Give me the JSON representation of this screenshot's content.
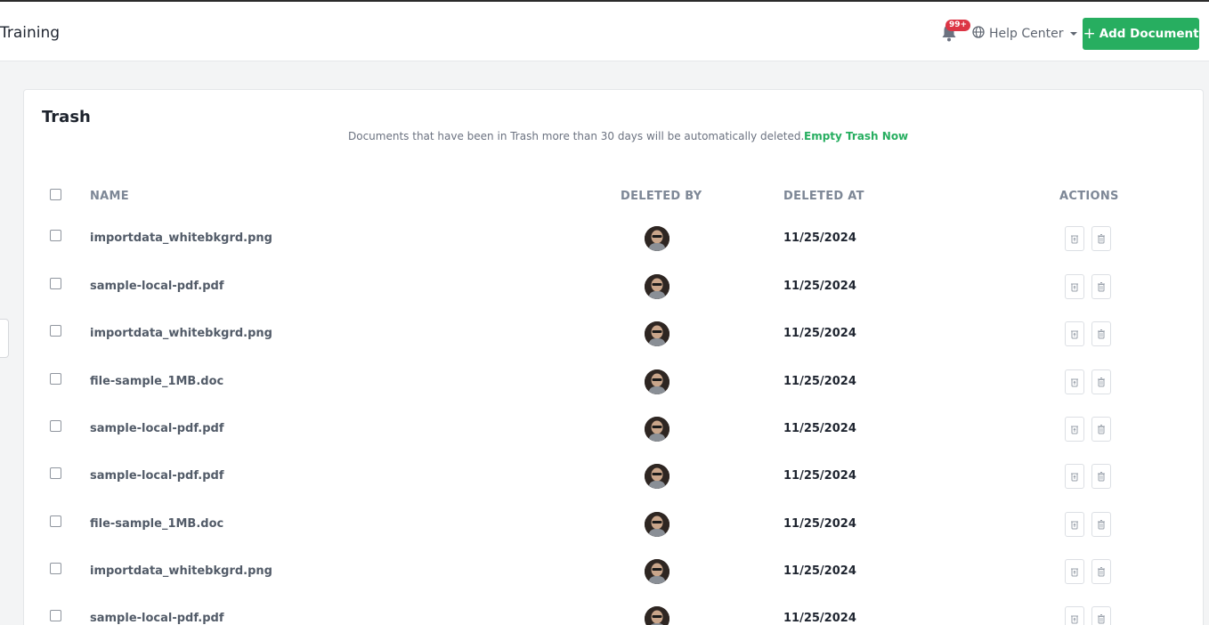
{
  "header": {
    "title": "Training",
    "notifications_badge": "99+",
    "help_label": "Help Center",
    "add_button_label": "Add Document"
  },
  "trash": {
    "title": "Trash",
    "notice": "Documents that have been in Trash more than 30 days will be automatically deleted.",
    "empty_link": "Empty Trash Now",
    "columns": {
      "name": "NAME",
      "deleted_by": "DELETED BY",
      "deleted_at": "DELETED AT",
      "actions": "ACTIONS"
    },
    "rows": [
      {
        "name": "importdata_whitebkgrd.png",
        "deleted_at": "11/25/2024"
      },
      {
        "name": "sample-local-pdf.pdf",
        "deleted_at": "11/25/2024"
      },
      {
        "name": "importdata_whitebkgrd.png",
        "deleted_at": "11/25/2024"
      },
      {
        "name": "file-sample_1MB.doc",
        "deleted_at": "11/25/2024"
      },
      {
        "name": "sample-local-pdf.pdf",
        "deleted_at": "11/25/2024"
      },
      {
        "name": "sample-local-pdf.pdf",
        "deleted_at": "11/25/2024"
      },
      {
        "name": "file-sample_1MB.doc",
        "deleted_at": "11/25/2024"
      },
      {
        "name": "importdata_whitebkgrd.png",
        "deleted_at": "11/25/2024"
      },
      {
        "name": "sample-local-pdf.pdf",
        "deleted_at": "11/25/2024"
      }
    ]
  },
  "icons": {
    "notifications": "bell-icon",
    "help": "globe-icon",
    "restore": "restore-icon",
    "delete": "trash-icon"
  },
  "colors": {
    "accent": "#27ae60",
    "badge": "#dc3545"
  }
}
